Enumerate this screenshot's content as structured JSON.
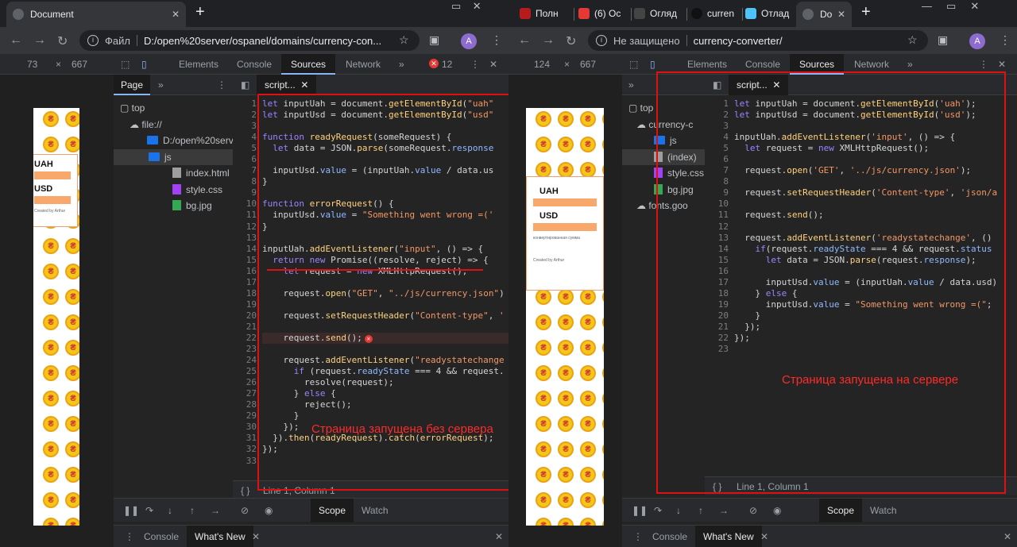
{
  "left": {
    "tab_title": "Document",
    "url_scheme": "Файл",
    "url": "D:/open%20server/ospanel/domains/currency-con...",
    "avatar": "A",
    "dims": {
      "w": "73",
      "h": "667"
    },
    "devtabs": [
      "Elements",
      "Console",
      "Sources",
      "Network"
    ],
    "devtools_more": "»",
    "error_count": "12",
    "nav_tab": "Page",
    "tree": [
      {
        "label": "top",
        "kind": "frame"
      },
      {
        "label": "file://",
        "kind": "cloud"
      },
      {
        "label": "D:/open%20serv",
        "kind": "folder"
      },
      {
        "label": "js",
        "kind": "folder"
      },
      {
        "label": "index.html",
        "kind": "file"
      },
      {
        "label": "style.css",
        "kind": "css"
      },
      {
        "label": "bg.jpg",
        "kind": "img"
      }
    ],
    "file_tab": "script...",
    "code": [
      "let inputUah = document.getElementById(\"uah\"",
      "let inputUsd = document.getElementById(\"usd\"",
      "",
      "function readyRequest(someRequest) {",
      "  let data = JSON.parse(someRequest.response",
      "",
      "  inputUsd.value = (inputUah.value / data.us",
      "}",
      "",
      "function errorRequest() {",
      "  inputUsd.value = \"Something went wrong =('",
      "}",
      "",
      "inputUah.addEventListener(\"input\", () => {",
      "  return new Promise((resolve, reject) => {",
      "    let request = new XMLHttpRequest();",
      "",
      "    request.open(\"GET\", \"../js/currency.json\")",
      "",
      "    request.setRequestHeader(\"Content-type\", '",
      "",
      "    request.send();",
      "",
      "    request.addEventListener(\"readystatechange",
      "      if (request.readyState === 4 && request.",
      "        resolve(request);",
      "      } else {",
      "        reject();",
      "      }",
      "    });",
      "  }).then(readyRequest).catch(errorRequest);",
      "});",
      ""
    ],
    "status": "Line 1, Column 1",
    "scope_tabs": [
      "Scope",
      "Watch"
    ],
    "drawer_tabs": [
      "Console",
      "What's New"
    ],
    "annotation": "Страница запущена без сервера",
    "preview": {
      "uah_label": "UAH",
      "usd_label": "USD",
      "footer": "Created by Arthur"
    }
  },
  "right": {
    "tabs": [
      "Полн",
      "(6) Ос",
      "Огляд",
      "curren",
      "Отлад",
      "Do"
    ],
    "url_scheme": "Не защищено",
    "url": "currency-converter/",
    "avatar": "A",
    "dims": {
      "w": "124",
      "h": "667"
    },
    "devtabs": [
      "Elements",
      "Console",
      "Sources",
      "Network"
    ],
    "devtools_more": "»",
    "tree": [
      {
        "label": "top",
        "kind": "frame"
      },
      {
        "label": "currency-c",
        "kind": "cloud"
      },
      {
        "label": "js",
        "kind": "folder"
      },
      {
        "label": "(index)",
        "kind": "file"
      },
      {
        "label": "style.css",
        "kind": "css"
      },
      {
        "label": "bg.jpg",
        "kind": "img"
      },
      {
        "label": "fonts.goo",
        "kind": "cloud"
      }
    ],
    "file_tab": "script...",
    "code": [
      "let inputUah = document.getElementById('uah');",
      "let inputUsd = document.getElementById('usd');",
      "",
      "inputUah.addEventListener('input', () => {",
      "  let request = new XMLHttpRequest();",
      "",
      "  request.open('GET', '../js/currency.json');",
      "",
      "  request.setRequestHeader('Content-type', 'json/a",
      "",
      "  request.send();",
      "",
      "  request.addEventListener('readystatechange', () ",
      "    if(request.readyState === 4 && request.status",
      "      let data = JSON.parse(request.response);",
      "",
      "      inputUsd.value = (inputUah.value / data.usd)",
      "    } else {",
      "      inputUsd.value = \"Something went wrong =(\";",
      "    }",
      "  });",
      "});",
      ""
    ],
    "status": "Line 1, Column 1",
    "scope_tabs": [
      "Scope",
      "Watch"
    ],
    "drawer_tabs": [
      "Console",
      "What's New"
    ],
    "annotation": "Страница запущена на сервере",
    "preview": {
      "uah_label": "UAH",
      "usd_label": "USD",
      "hint": "конвертированная сумма",
      "footer": "Created by Arthur"
    }
  }
}
